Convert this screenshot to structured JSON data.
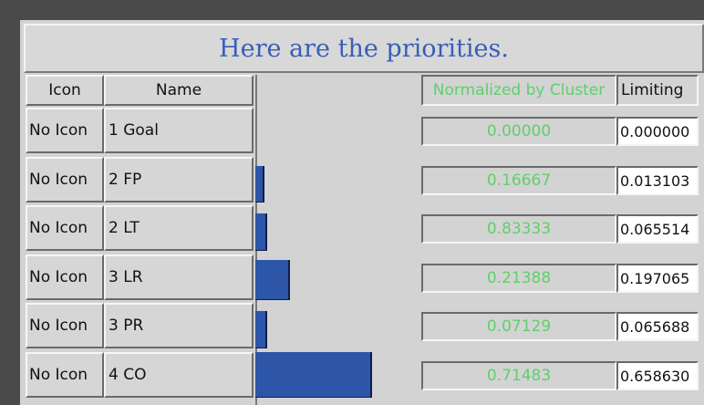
{
  "title": "Here are the priorities.",
  "headers": {
    "icon": "Icon",
    "name": "Name",
    "normalized": "Normalized by Cluster",
    "limiting": "Limiting"
  },
  "colors": {
    "title": "#3a5db8",
    "bar": "#2d55a8",
    "normalized_text": "#5ed06a"
  },
  "rows": [
    {
      "icon": "No Icon",
      "name": "1 Goal",
      "normalized": "0.00000",
      "limiting": "0.000000",
      "limiting_value": 0.0
    },
    {
      "icon": "No Icon",
      "name": "2 FP",
      "normalized": "0.16667",
      "limiting": "0.013103",
      "limiting_value": 0.013103
    },
    {
      "icon": "No Icon",
      "name": "2 LT",
      "normalized": "0.83333",
      "limiting": "0.065514",
      "limiting_value": 0.065514
    },
    {
      "icon": "No Icon",
      "name": "3 LR",
      "normalized": "0.21388",
      "limiting": "0.197065",
      "limiting_value": 0.197065
    },
    {
      "icon": "No Icon",
      "name": "3 PR",
      "normalized": "0.07129",
      "limiting": "0.065688",
      "limiting_value": 0.065688
    },
    {
      "icon": "No Icon",
      "name": "4 CO",
      "normalized": "0.71483",
      "limiting": "0.658630",
      "limiting_value": 0.65863
    }
  ]
}
